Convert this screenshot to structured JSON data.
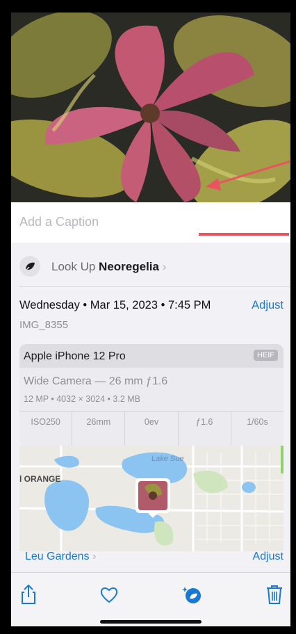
{
  "caption": {
    "placeholder": "Add a Caption"
  },
  "lookup": {
    "prefix": "Look Up ",
    "subject": "Neoregelia",
    "chevron": "›"
  },
  "details": {
    "date": "Wednesday • Mar 15, 2023 • 7:45 PM",
    "adjust_label": "Adjust",
    "filename": "IMG_8355"
  },
  "camera": {
    "model": "Apple iPhone 12 Pro",
    "format_badge": "HEIF",
    "lens": "Wide Camera — 26 mm ƒ1.6",
    "specs": "12 MP • 4032 × 3024 • 3.2 MB",
    "exif": [
      "ISO250",
      "26mm",
      "0ev",
      "ƒ1.6",
      "1/60s"
    ]
  },
  "map": {
    "lake_label": "Lake Sue",
    "area_label": "l ORANGE",
    "location": "Leu Gardens",
    "location_chevron": "›",
    "adjust_label": "Adjust"
  },
  "toolbar": {
    "share_icon": "share-icon",
    "favorite_icon": "heart-icon",
    "visual_lookup_icon": "visual-lookup-icon",
    "delete_icon": "trash-icon"
  },
  "colors": {
    "accent": "#1778d6",
    "annotation_arrow": "#e8555f"
  }
}
